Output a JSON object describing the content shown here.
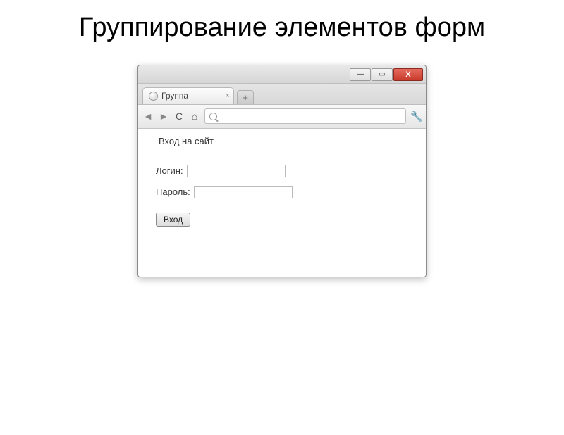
{
  "slide": {
    "title": "Группирование элементов форм"
  },
  "window": {
    "minimize": "—",
    "maximize": "▭",
    "close": "X"
  },
  "tab": {
    "title": "Группа",
    "close": "×",
    "newtab": "+"
  },
  "toolbar": {
    "back": "◄",
    "forward": "►",
    "reload": "C",
    "home": "⌂",
    "wrench": "🔧",
    "address_value": ""
  },
  "form": {
    "legend": "Вход на сайт",
    "login_label": "Логин:",
    "login_value": "",
    "password_label": "Пароль:",
    "password_value": "",
    "submit_label": "Вход"
  }
}
